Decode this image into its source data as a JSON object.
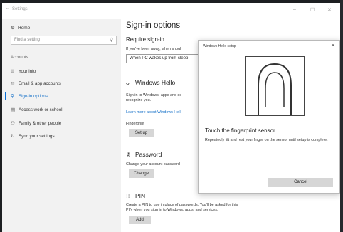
{
  "window": {
    "title": "Settings",
    "back": "←",
    "controls": {
      "minimize": "–",
      "maximize": "☐",
      "close": "✕"
    }
  },
  "sidebar": {
    "home": "Home",
    "search_placeholder": "Find a setting",
    "section": "Accounts",
    "items": [
      {
        "label": "Your info",
        "icon": "person-card-icon",
        "glyph": "⊟"
      },
      {
        "label": "Email & app accounts",
        "icon": "envelope-icon",
        "glyph": "✉"
      },
      {
        "label": "Sign-in options",
        "icon": "key-icon",
        "glyph": "⚲"
      },
      {
        "label": "Access work or school",
        "icon": "briefcase-icon",
        "glyph": "▤"
      },
      {
        "label": "Family & other people",
        "icon": "people-icon",
        "glyph": "⚇"
      },
      {
        "label": "Sync your settings",
        "icon": "sync-icon",
        "glyph": "↻"
      }
    ],
    "selected_index": 2
  },
  "main": {
    "title": "Sign-in options",
    "require": {
      "heading": "Require sign-in",
      "text": "If you've been away, when shoul",
      "dropdown_value": "When PC wakes up from sleep"
    },
    "hello": {
      "heading": "Windows Hello",
      "text1": "Sign in to Windows, apps and se",
      "text2": "recognize you.",
      "link": "Learn more about Windows Hell",
      "fingerprint_label": "Fingerprint",
      "setup_button": "Set up"
    },
    "password": {
      "heading": "Password",
      "text": "Change your account password",
      "button": "Change"
    },
    "pin": {
      "heading": "PIN",
      "text1": "Create a PIN to use in place of passwords. You'll be asked for this",
      "text2": "PIN when you sign in to Windows, apps, and services.",
      "button": "Add"
    }
  },
  "dialog": {
    "title": "Windows Hello setup",
    "close": "✕",
    "heading": "Touch the fingerprint sensor",
    "body": "Repeatedly lift and rest your finger on the sensor until setup is complete.",
    "cancel": "Cancel"
  },
  "colors": {
    "accent": "#0a6fd6",
    "link": "#1a73c9",
    "button": "#d6d6d6",
    "sidebar_bg": "#f2f2f2"
  }
}
